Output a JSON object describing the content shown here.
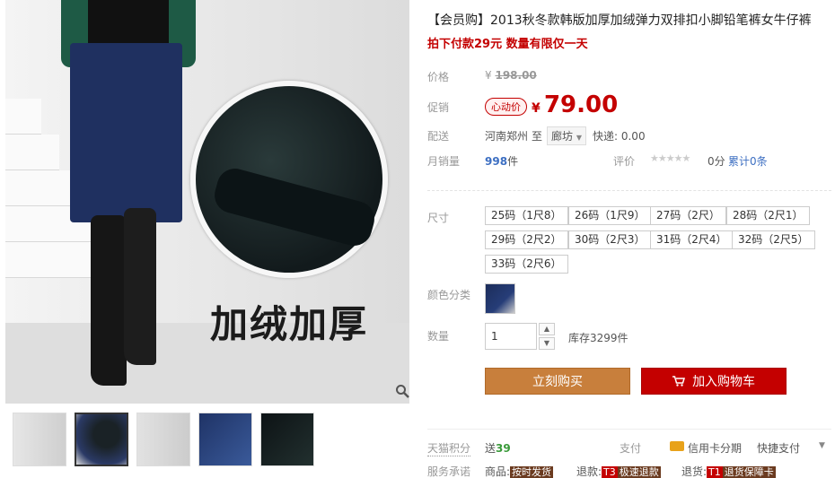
{
  "gallery": {
    "overlay_text": "加绒加厚",
    "zoom_icon": "magnifier-icon",
    "thumbnails": [
      {
        "fill": "#d7d7d7",
        "active": false
      },
      {
        "fill": "#2b3444",
        "active": true
      },
      {
        "fill": "#cfcfcf",
        "active": false
      },
      {
        "fill": "#2d4a86",
        "active": false
      },
      {
        "fill": "#121a1d",
        "active": false
      }
    ]
  },
  "product": {
    "title": "【会员购】2013秋冬款韩版加厚加绒弹力双排扣小脚铅笔裤女牛仔裤",
    "promo": "拍下付款29元 数量有限仅一天",
    "price_label": "价格",
    "original_currency": "¥",
    "original_price": "198.00",
    "promo_label": "促销",
    "promo_badge": "心动价",
    "sale_currency": "¥",
    "sale_price": "79.00",
    "ship_label": "配送",
    "ship_from": "河南郑州",
    "ship_to_prefix": "至",
    "ship_to": "廊坊",
    "ship_fee": "快递: 0.00",
    "sales_label": "月销量",
    "sales_count": "998",
    "sales_unit": "件",
    "rating_label": "评价",
    "stars": "★★★★★",
    "rating_score": "0分",
    "reviews": "累计0条"
  },
  "options": {
    "size_label": "尺寸",
    "sizes": [
      "25码（1尺8）",
      "26码（1尺9）",
      "27码（2尺）",
      "28码（2尺1）",
      "29码（2尺2）",
      "30码（2尺3）",
      "31码（2尺4）",
      "32码（2尺5）",
      "33码（2尺6）"
    ],
    "color_label": "颜色分类",
    "qty_label": "数量",
    "qty_value": "1",
    "stock": "库存3299件"
  },
  "actions": {
    "buy": "立刻购买",
    "cart": "加入购物车"
  },
  "footer": {
    "points_label": "天猫积分",
    "points_prefix": "送",
    "points_value": "39",
    "pay_label": "支付",
    "pay_credit": "信用卡分期",
    "pay_quick": "快捷支付",
    "service_label": "服务承诺",
    "svc_goods_prefix": "商品:",
    "svc_goods_tag": "按时发货",
    "svc_refund_prefix": "退款:",
    "svc_refund_num": "T3",
    "svc_refund_tag": "极速退款",
    "svc_return_prefix": "退货:",
    "svc_return_num": "T1",
    "svc_return_tag": "退货保障卡"
  }
}
